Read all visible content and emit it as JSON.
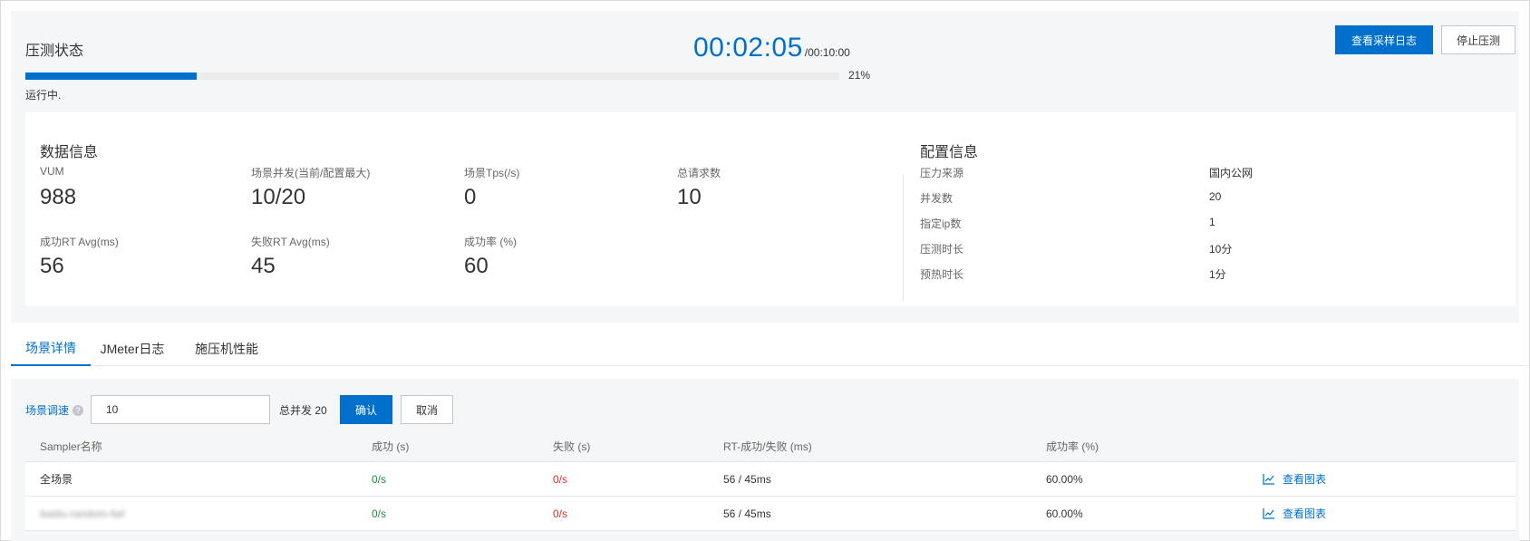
{
  "status": {
    "title": "压测状态",
    "elapsed": "00:02:05",
    "total": "/00:10:00",
    "progress_pct": 21,
    "progress_label": "21%",
    "run_state": "运行中.",
    "buttons": {
      "view_log": "查看采样日志",
      "stop": "停止压测"
    }
  },
  "data_info": {
    "title": "数据信息",
    "metrics": [
      {
        "label": "VUM",
        "value": "988"
      },
      {
        "label": "场景并发(当前/配置最大)",
        "value": "10/20"
      },
      {
        "label": "场景Tps(/s)",
        "value": "0"
      },
      {
        "label": "总请求数",
        "value": "10"
      },
      {
        "label": "成功RT Avg(ms)",
        "value": "56"
      },
      {
        "label": "失败RT Avg(ms)",
        "value": "45"
      },
      {
        "label": "成功率 (%)",
        "value": "60"
      }
    ]
  },
  "config_info": {
    "title": "配置信息",
    "rows": [
      {
        "label": "压力来源",
        "value": "国内公网"
      },
      {
        "label": "并发数",
        "value": "20"
      },
      {
        "label": "指定ip数",
        "value": "1"
      },
      {
        "label": "压测时长",
        "value": "10分"
      },
      {
        "label": "预热时长",
        "value": "1分"
      }
    ]
  },
  "tabs": [
    {
      "label": "场景详情",
      "active": true
    },
    {
      "label": "JMeter日志",
      "active": false
    },
    {
      "label": "施压机性能",
      "active": false
    }
  ],
  "speed": {
    "label": "场景调速",
    "help_icon": "help-icon",
    "input_value": "10",
    "total_concurrency": "总并发 20",
    "confirm": "确认",
    "cancel": "取消"
  },
  "table": {
    "headers": [
      "Sampler名称",
      "成功 (s)",
      "失败 (s)",
      "RT-成功/失败 (ms)",
      "成功率 (%)"
    ],
    "rows": [
      {
        "name": "全场景",
        "success": "0/s",
        "fail": "0/s",
        "rt": "56 / 45ms",
        "rate": "60.00%",
        "action": "查看图表"
      },
      {
        "name": "baidu-random-fail",
        "success": "0/s",
        "fail": "0/s",
        "rt": "56 / 45ms",
        "rate": "60.00%",
        "action": "查看图表"
      }
    ]
  },
  "colors": {
    "primary": "#0070cc",
    "success": "#1e8e3e",
    "fail": "#d93026"
  }
}
